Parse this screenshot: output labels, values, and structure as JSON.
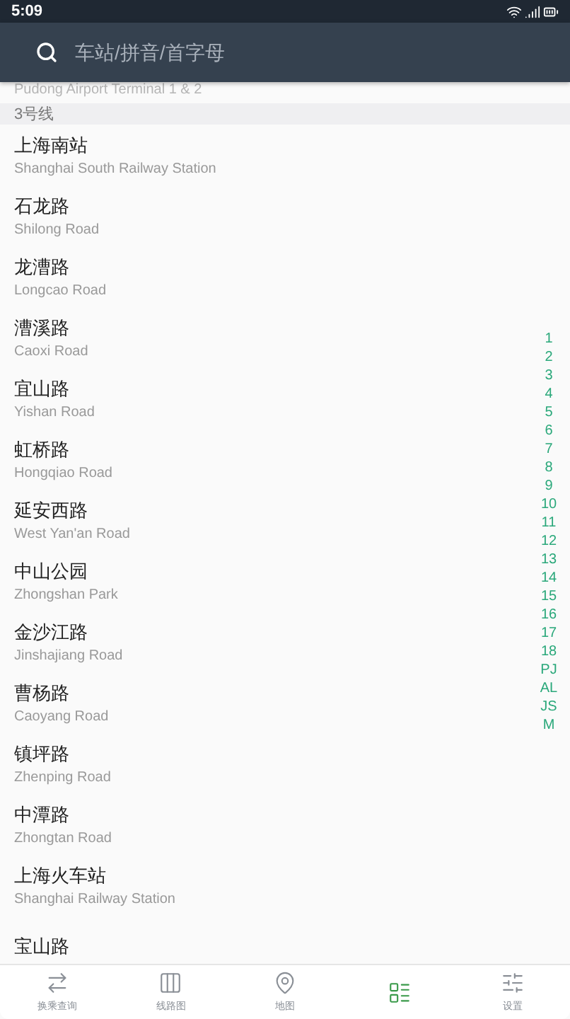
{
  "status_bar": {
    "time": "5:09"
  },
  "search": {
    "placeholder": "车站/拼音/首字母"
  },
  "cut_subtitle": "Pudong Airport Terminal 1 & 2",
  "section": "3号线",
  "stations": [
    {
      "name": "上海南站",
      "english": "Shanghai South Railway Station"
    },
    {
      "name": "石龙路",
      "english": "Shilong Road"
    },
    {
      "name": "龙漕路",
      "english": "Longcao Road"
    },
    {
      "name": "漕溪路",
      "english": "Caoxi Road"
    },
    {
      "name": "宜山路",
      "english": "Yishan Road"
    },
    {
      "name": "虹桥路",
      "english": "Hongqiao Road"
    },
    {
      "name": "延安西路",
      "english": "West Yan'an Road"
    },
    {
      "name": "中山公园",
      "english": "Zhongshan Park"
    },
    {
      "name": "金沙江路",
      "english": "Jinshajiang Road"
    },
    {
      "name": "曹杨路",
      "english": "Caoyang Road"
    },
    {
      "name": "镇坪路",
      "english": "Zhenping Road"
    },
    {
      "name": "中潭路",
      "english": "Zhongtan Road"
    },
    {
      "name": "上海火车站",
      "english": "Shanghai Railway Station"
    },
    {
      "name": "宝山路"
    }
  ],
  "index": [
    "1",
    "2",
    "3",
    "4",
    "5",
    "6",
    "7",
    "8",
    "9",
    "10",
    "11",
    "12",
    "13",
    "14",
    "15",
    "16",
    "17",
    "18",
    "PJ",
    "AL",
    "JS",
    "M"
  ],
  "nav": [
    {
      "kind": "transfer",
      "label": "换乘查询",
      "selected": false
    },
    {
      "kind": "lines",
      "label": "线路图",
      "selected": false
    },
    {
      "kind": "map",
      "label": "地图",
      "selected": false
    },
    {
      "kind": "station",
      "selected": true
    },
    {
      "kind": "settings",
      "label": "设置",
      "selected": false
    }
  ]
}
